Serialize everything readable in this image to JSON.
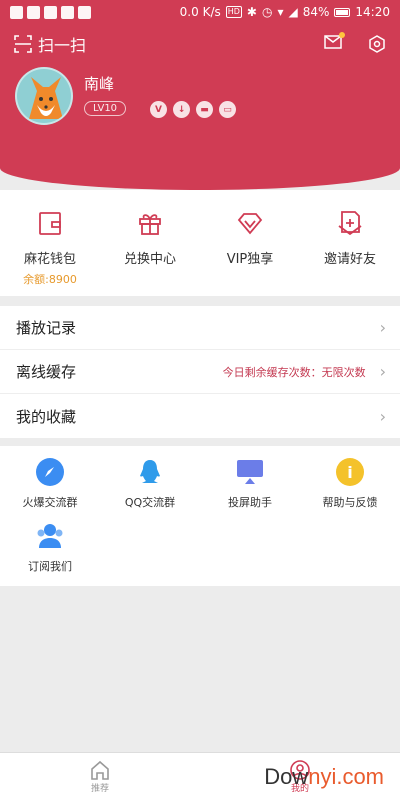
{
  "statusbar": {
    "speed": "0.0 K/s",
    "hd": "HD",
    "battery": "84%",
    "time": "14:20"
  },
  "header": {
    "scan_label": "扫一扫",
    "username": "南峰",
    "level": "LV10",
    "badges": [
      "V",
      "↓",
      "▬",
      "▭"
    ]
  },
  "quick_actions": [
    {
      "label": "麻花钱包",
      "sub": "余额:8900",
      "icon": "wallet-icon"
    },
    {
      "label": "兑换中心",
      "sub": "",
      "icon": "gift-icon"
    },
    {
      "label": "VIP独享",
      "sub": "",
      "icon": "diamond-icon"
    },
    {
      "label": "邀请好友",
      "sub": "",
      "icon": "invite-icon"
    }
  ],
  "list": [
    {
      "label": "播放记录",
      "note": ""
    },
    {
      "label": "离线缓存",
      "note": "今日剩余缓存次数：无限次数"
    },
    {
      "label": "我的收藏",
      "note": ""
    }
  ],
  "services": [
    {
      "label": "火爆交流群",
      "icon": "rocket-icon",
      "color": "#3b8df2"
    },
    {
      "label": "QQ交流群",
      "icon": "qq-icon",
      "color": "#2f9bea"
    },
    {
      "label": "投屏助手",
      "icon": "cast-icon",
      "color": "#6b7de8"
    },
    {
      "label": "帮助与反馈",
      "icon": "info-icon",
      "color": "#f4c22b"
    },
    {
      "label": "订阅我们",
      "icon": "subscribe-icon",
      "color": "#3b8df2"
    }
  ],
  "nav": [
    {
      "label": "推荐",
      "icon": "home-icon"
    },
    {
      "label": "我的",
      "icon": "profile-icon"
    }
  ],
  "watermark": {
    "part1": "Dow",
    "part2": "nyi.com"
  },
  "colors": {
    "primary": "#d03c54",
    "accent": "#e79a2d"
  }
}
